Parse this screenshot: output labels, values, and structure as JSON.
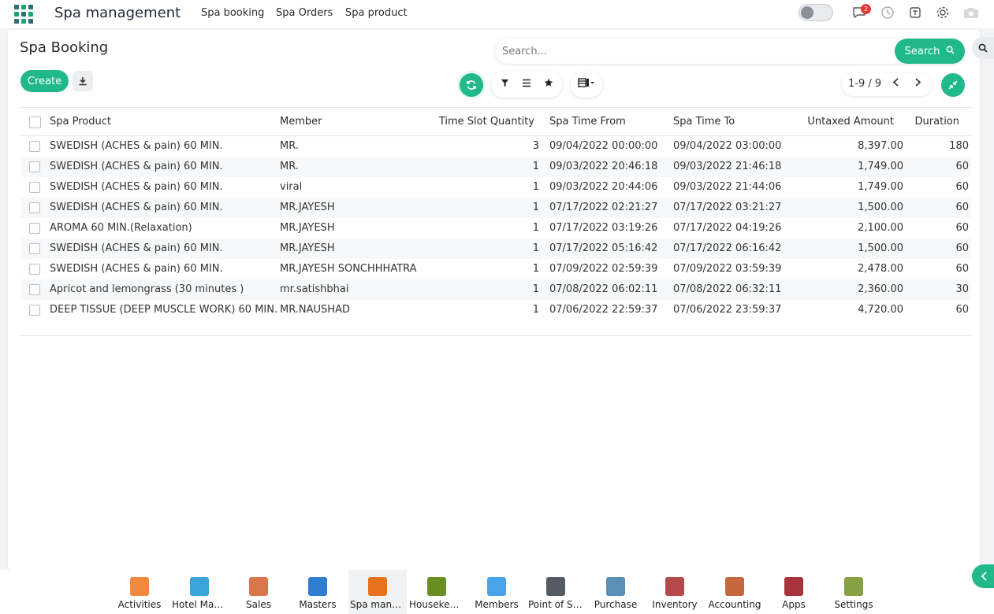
{
  "app": {
    "title": "Spa management"
  },
  "nav": {
    "items": [
      "Spa booking",
      "Spa Orders",
      "Spa product"
    ]
  },
  "notifications": {
    "count": "2"
  },
  "page": {
    "title": "Spa Booking"
  },
  "search": {
    "placeholder": "Search...",
    "button_label": "Search"
  },
  "toolbar": {
    "create_label": "Create"
  },
  "pager": {
    "text": "1-9 / 9"
  },
  "table": {
    "columns": [
      "Spa Product",
      "Member",
      "Time Slot Quantity",
      "Spa Time From",
      "Spa Time To",
      "Untaxed Amount",
      "Duration"
    ],
    "rows": [
      {
        "product": "SWEDISH (ACHES & pain) 60 MIN.",
        "member": "MR.",
        "qty": "3",
        "from": "09/04/2022 00:00:00",
        "to": "09/04/2022 03:00:00",
        "amount": "8,397.00",
        "duration": "180"
      },
      {
        "product": "SWEDISH (ACHES & pain) 60 MIN.",
        "member": "MR.",
        "qty": "1",
        "from": "09/03/2022 20:46:18",
        "to": "09/03/2022 21:46:18",
        "amount": "1,749.00",
        "duration": "60"
      },
      {
        "product": "SWEDISH (ACHES & pain) 60 MIN.",
        "member": "viral",
        "qty": "1",
        "from": "09/03/2022 20:44:06",
        "to": "09/03/2022 21:44:06",
        "amount": "1,749.00",
        "duration": "60"
      },
      {
        "product": "SWEDISH (ACHES & pain) 60 MIN.",
        "member": "MR.JAYESH",
        "qty": "1",
        "from": "07/17/2022 02:21:27",
        "to": "07/17/2022 03:21:27",
        "amount": "1,500.00",
        "duration": "60"
      },
      {
        "product": "AROMA 60 MIN.(Relaxation)",
        "member": "MR.JAYESH",
        "qty": "1",
        "from": "07/17/2022 03:19:26",
        "to": "07/17/2022 04:19:26",
        "amount": "2,100.00",
        "duration": "60"
      },
      {
        "product": "SWEDISH (ACHES & pain) 60 MIN.",
        "member": "MR.JAYESH",
        "qty": "1",
        "from": "07/17/2022 05:16:42",
        "to": "07/17/2022 06:16:42",
        "amount": "1,500.00",
        "duration": "60"
      },
      {
        "product": "SWEDISH (ACHES & pain) 60 MIN.",
        "member": "MR.JAYESH SONCHHHATRA",
        "qty": "1",
        "from": "07/09/2022 02:59:39",
        "to": "07/09/2022 03:59:39",
        "amount": "2,478.00",
        "duration": "60"
      },
      {
        "product": "Apricot and lemongrass (30 minutes )",
        "member": "mr.satishbhai",
        "qty": "1",
        "from": "07/08/2022 06:02:11",
        "to": "07/08/2022 06:32:11",
        "amount": "2,360.00",
        "duration": "30"
      },
      {
        "product": "DEEP TISSUE (DEEP MUSCLE WORK) 60 MIN.",
        "member": "MR.NAUSHAD",
        "qty": "1",
        "from": "07/06/2022 22:59:37",
        "to": "07/06/2022 23:59:37",
        "amount": "4,720.00",
        "duration": "60"
      }
    ]
  },
  "dock": {
    "items": [
      {
        "label": "Activities",
        "icon": "activities-icon",
        "color": "#f0883e"
      },
      {
        "label": "Hotel Man...",
        "icon": "hotel-icon",
        "color": "#3ba4d8"
      },
      {
        "label": "Sales",
        "icon": "sales-icon",
        "color": "#d9764a"
      },
      {
        "label": "Masters",
        "icon": "masters-icon",
        "color": "#2f7dd1"
      },
      {
        "label": "Spa mana...",
        "icon": "spa-icon",
        "color": "#e8731f"
      },
      {
        "label": "Housekee...",
        "icon": "housekeeping-icon",
        "color": "#6b8e23"
      },
      {
        "label": "Members",
        "icon": "members-icon",
        "color": "#4aa3e8"
      },
      {
        "label": "Point of Sa...",
        "icon": "pos-icon",
        "color": "#555b63"
      },
      {
        "label": "Purchase",
        "icon": "purchase-icon",
        "color": "#5b8fb5"
      },
      {
        "label": "Inventory",
        "icon": "inventory-icon",
        "color": "#b5484a"
      },
      {
        "label": "Accounting",
        "icon": "accounting-icon",
        "color": "#c7673e"
      },
      {
        "label": "Apps",
        "icon": "apps-icon",
        "color": "#a8343e"
      },
      {
        "label": "Settings",
        "icon": "settings-icon",
        "color": "#86a144"
      }
    ]
  },
  "colors": {
    "accent": "#22b98a",
    "badge": "#e53935"
  }
}
